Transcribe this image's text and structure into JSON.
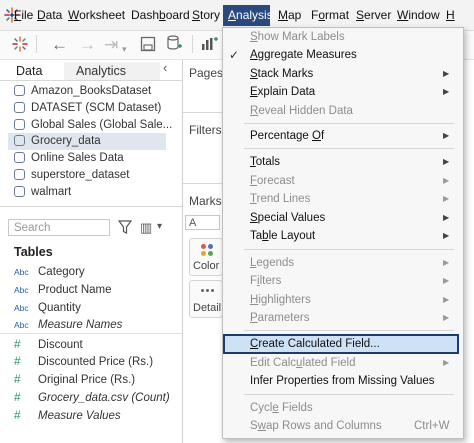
{
  "menubar": {
    "items": [
      {
        "key": "F",
        "rest": "ile"
      },
      {
        "key": "D",
        "rest": "ata"
      },
      {
        "key": "W",
        "rest": "orksheet"
      },
      {
        "pre": "Dash",
        "key": "b",
        "rest": "oard"
      },
      {
        "key": "S",
        "rest": "tory"
      },
      {
        "key": "A",
        "rest": "nalysis"
      },
      {
        "key": "M",
        "rest": "ap"
      },
      {
        "pre": "F",
        "key": "o",
        "rest": "rmat"
      },
      {
        "key": "S",
        "rest": "erver"
      },
      {
        "key": "W",
        "rest": "indow"
      },
      {
        "key": "H",
        "rest": ""
      }
    ],
    "active_color": "#2a4a7d"
  },
  "data_pane": {
    "tab_data": "Data",
    "tab_analytics": "Analytics",
    "collapse_glyph": "‹",
    "datasources": [
      "Amazon_BooksDataset",
      "DATASET (SCM Dataset)",
      "Global Sales (Global Sale...",
      "Grocery_data",
      "Online Sales Data",
      "superstore_dataset",
      "walmart"
    ],
    "search_placeholder": "Search",
    "tables_header": "Tables",
    "dimensions": [
      {
        "prefix": "Abc",
        "name": "Category",
        "italic": false
      },
      {
        "prefix": "Abc",
        "name": "Product Name",
        "italic": false
      },
      {
        "prefix": "Abc",
        "name": "Quantity",
        "italic": false
      },
      {
        "prefix": "Abc",
        "name": "Measure Names",
        "italic": true
      }
    ],
    "measures": [
      {
        "prefix": "#",
        "name": "Discount",
        "italic": false
      },
      {
        "prefix": "#",
        "name": "Discounted Price (Rs.)",
        "italic": false
      },
      {
        "prefix": "#",
        "name": "Original Price (Rs.)",
        "italic": false
      },
      {
        "prefix": "#",
        "name": "Grocery_data.csv (Count)",
        "italic": true
      },
      {
        "prefix": "#",
        "name": "Measure Values",
        "italic": true
      }
    ]
  },
  "shelves": {
    "pages": "Pages",
    "filters": "Filters",
    "marks": "Marks",
    "marks_type": "A",
    "color": "Color",
    "detail": "Detail"
  },
  "analysis_menu": {
    "items": [
      {
        "pre": "",
        "key": "S",
        "rest": "how Mark Labels",
        "disabled": true,
        "arrow": false
      },
      {
        "pre": "",
        "key": "A",
        "rest": "ggregate Measures",
        "disabled": false,
        "arrow": false,
        "checked": true
      },
      {
        "pre": "",
        "key": "S",
        "rest": "tack Marks",
        "disabled": false,
        "arrow": true
      },
      {
        "pre": "",
        "key": "E",
        "rest": "xplain Data",
        "disabled": false,
        "arrow": true
      },
      {
        "pre": "",
        "key": "R",
        "rest": "eveal Hidden Data",
        "disabled": true,
        "arrow": false
      },
      {
        "pre": "Percentage ",
        "key": "O",
        "rest": "f",
        "disabled": false,
        "arrow": true
      },
      {
        "pre": "",
        "key": "T",
        "rest": "otals",
        "disabled": false,
        "arrow": true
      },
      {
        "pre": "",
        "key": "F",
        "rest": "orecast",
        "disabled": true,
        "arrow": true
      },
      {
        "pre": "",
        "key": "T",
        "rest": "rend Lines",
        "disabled": true,
        "arrow": true
      },
      {
        "pre": "",
        "key": "S",
        "rest": "pecial Values",
        "disabled": false,
        "arrow": true
      },
      {
        "pre": "Ta",
        "key": "b",
        "rest": "le Layout",
        "disabled": false,
        "arrow": true
      },
      {
        "pre": "",
        "key": "L",
        "rest": "egends",
        "disabled": true,
        "arrow": true
      },
      {
        "pre": "F",
        "key": "i",
        "rest": "lters",
        "disabled": true,
        "arrow": true
      },
      {
        "pre": "",
        "key": "H",
        "rest": "ighlighters",
        "disabled": true,
        "arrow": true
      },
      {
        "pre": "",
        "key": "P",
        "rest": "arameters",
        "disabled": true,
        "arrow": true
      },
      {
        "pre": "",
        "key": "C",
        "rest": "reate Calculated Field...",
        "disabled": false,
        "arrow": false,
        "highlighted": true
      },
      {
        "pre": "Edit Calc",
        "key": "u",
        "rest": "lated Field",
        "disabled": true,
        "arrow": true
      },
      {
        "pre": "",
        "key": "",
        "rest": "Infer Properties from Missing Values",
        "disabled": false,
        "arrow": false
      },
      {
        "pre": "Cycl",
        "key": "e",
        "rest": " Fields",
        "disabled": true,
        "arrow": false
      },
      {
        "pre": "S",
        "key": "w",
        "rest": "ap Rows and Columns",
        "disabled": true,
        "arrow": false,
        "shortcut": "Ctrl+W"
      }
    ],
    "highlight_color": "#cfe1f5",
    "highlight_border": "#1d3c6d"
  }
}
